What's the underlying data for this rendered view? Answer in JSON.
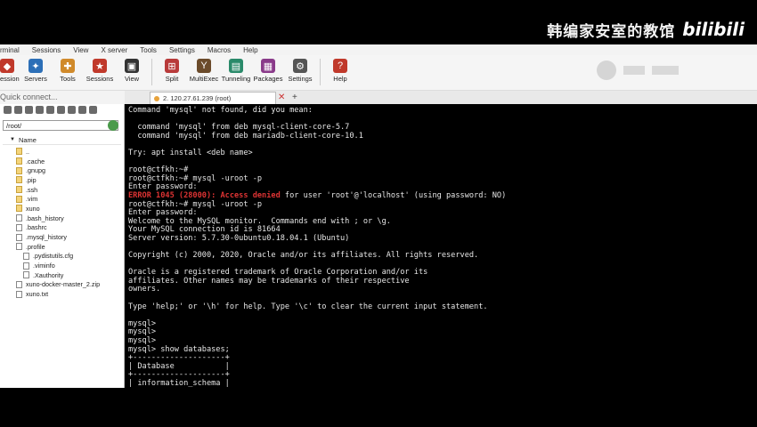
{
  "watermark": {
    "text": "韩编家安室的教馆",
    "logo": "bilibili"
  },
  "menu": [
    "rminal",
    "Sessions",
    "View",
    "X server",
    "Tools",
    "Settings",
    "Macros",
    "Help"
  ],
  "ribbon": [
    {
      "label": "ession",
      "icon": "session-icon",
      "color": "#c0392b"
    },
    {
      "label": "Servers",
      "icon": "servers-icon",
      "color": "#2c6fb7"
    },
    {
      "label": "Tools",
      "icon": "tools-icon",
      "color": "#d08a2b"
    },
    {
      "label": "Sessions",
      "icon": "sessions-star-icon",
      "color": "#c0392b"
    },
    {
      "label": "View",
      "icon": "view-icon",
      "color": "#333333"
    },
    {
      "label": "Split",
      "icon": "split-icon",
      "color": "#b83a3a"
    },
    {
      "label": "MultiExec",
      "icon": "multiexec-icon",
      "color": "#6b4b2b"
    },
    {
      "label": "Tunneling",
      "icon": "tunneling-icon",
      "color": "#2a8a6a"
    },
    {
      "label": "Packages",
      "icon": "packages-icon",
      "color": "#8a3a8a"
    },
    {
      "label": "Settings",
      "icon": "gear-icon",
      "color": "#555555"
    },
    {
      "label": "Help",
      "icon": "help-icon",
      "color": "#c0392b"
    }
  ],
  "quick_connect": "Quick connect...",
  "tab": {
    "label": "2. 120.27.61.239 (root)"
  },
  "sidebar": {
    "path": "/root/",
    "column": "Name",
    "files": [
      {
        "name": "..",
        "type": "folder",
        "level": 0
      },
      {
        "name": ".cache",
        "type": "folder",
        "level": 0
      },
      {
        "name": ".gnupg",
        "type": "folder",
        "level": 0
      },
      {
        "name": ".pip",
        "type": "folder",
        "level": 0
      },
      {
        "name": ".ssh",
        "type": "folder",
        "level": 0
      },
      {
        "name": ".vim",
        "type": "folder",
        "level": 0
      },
      {
        "name": "xuno",
        "type": "folder",
        "level": 0
      },
      {
        "name": ".bash_history",
        "type": "file",
        "level": 0
      },
      {
        "name": ".bashrc",
        "type": "file",
        "level": 0
      },
      {
        "name": ".mysql_history",
        "type": "file",
        "level": 0
      },
      {
        "name": ".profile",
        "type": "file",
        "level": 0
      },
      {
        "name": ".pydistutils.cfg",
        "type": "file",
        "level": 1
      },
      {
        "name": ".viminfo",
        "type": "file",
        "level": 1
      },
      {
        "name": ".Xauthority",
        "type": "file",
        "level": 1
      },
      {
        "name": "xuno-docker-master_2.zip",
        "type": "file",
        "level": 0
      },
      {
        "name": "xuno.txt",
        "type": "file",
        "level": 0
      }
    ]
  },
  "terminal": {
    "lines": [
      {
        "t": "Command 'mysql' not found, did you mean:"
      },
      {
        "t": ""
      },
      {
        "t": "  command 'mysql' from deb mysql-client-core-5.7"
      },
      {
        "t": "  command 'mysql' from deb mariadb-client-core-10.1"
      },
      {
        "t": ""
      },
      {
        "t": "Try: apt install <deb name>"
      },
      {
        "t": ""
      },
      {
        "t": "root@ctfkh:~#"
      },
      {
        "t": "root@ctfkh:~# mysql -uroot -p"
      },
      {
        "t": "Enter password:"
      },
      {
        "err": "ERROR 1045 (28000): Access denied",
        "t": " for user 'root'@'localhost' (using password: NO)"
      },
      {
        "t": "root@ctfkh:~# mysql -uroot -p"
      },
      {
        "t": "Enter password:"
      },
      {
        "t": "Welcome to the MySQL monitor.  Commands end with ; or \\g."
      },
      {
        "t": "Your MySQL connection id is 81664"
      },
      {
        "t": "Server version: 5.7.30-0ubuntu0.18.04.1 (Ubuntu)"
      },
      {
        "t": ""
      },
      {
        "t": "Copyright (c) 2000, 2020, Oracle and/or its affiliates. All rights reserved."
      },
      {
        "t": ""
      },
      {
        "t": "Oracle is a registered trademark of Oracle Corporation and/or its"
      },
      {
        "t": "affiliates. Other names may be trademarks of their respective"
      },
      {
        "t": "owners."
      },
      {
        "t": ""
      },
      {
        "t": "Type 'help;' or '\\h' for help. Type '\\c' to clear the current input statement."
      },
      {
        "t": ""
      },
      {
        "t": "mysql>"
      },
      {
        "t": "mysql>"
      },
      {
        "t": "mysql>"
      },
      {
        "t": "mysql> show databases;"
      },
      {
        "t": "+--------------------+"
      },
      {
        "t": "| Database           |"
      },
      {
        "t": "+--------------------+"
      },
      {
        "t": "| information_schema |"
      }
    ]
  }
}
